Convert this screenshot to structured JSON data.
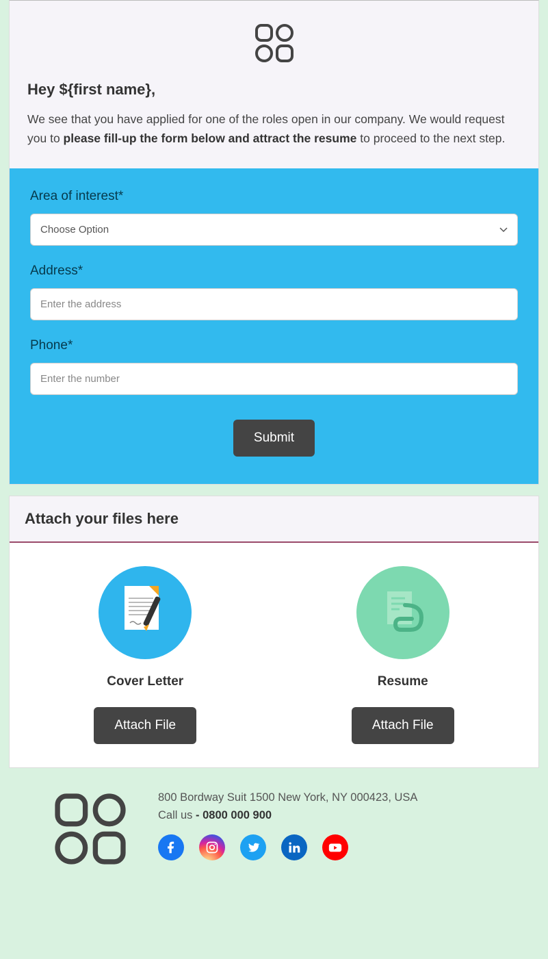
{
  "header": {
    "greeting": "Hey ${first name},",
    "intro_pre": "We see that you have applied for one of the roles open in our company. We would request you to ",
    "intro_bold": "please fill-up the form below and attract the resume",
    "intro_post": " to proceed to the next step."
  },
  "form": {
    "area_label": "Area of interest*",
    "area_placeholder": "Choose Option",
    "address_label": "Address*",
    "address_placeholder": "Enter the address",
    "phone_label": "Phone*",
    "phone_placeholder": "Enter the number",
    "submit_label": "Submit"
  },
  "attach": {
    "heading": "Attach your files here",
    "cover_label": "Cover Letter",
    "resume_label": "Resume",
    "button_label": "Attach File"
  },
  "footer": {
    "address": "800 Bordway Suit 1500 New York, NY 000423, USA",
    "call_label": "Call us ",
    "phone_prefix": "- ",
    "phone": "0800 000 900"
  }
}
